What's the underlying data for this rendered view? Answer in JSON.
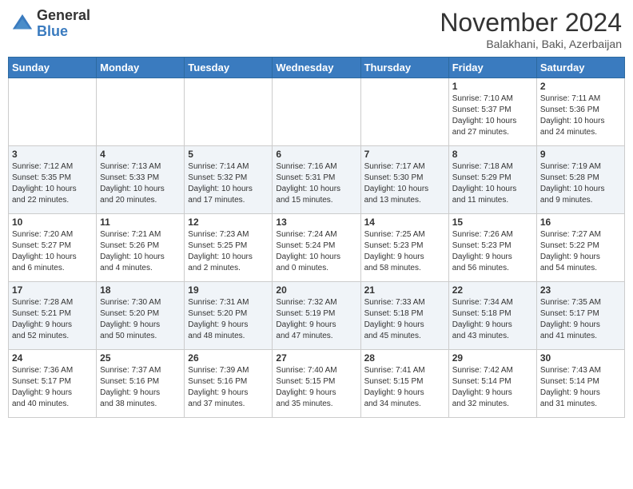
{
  "header": {
    "logo_general": "General",
    "logo_blue": "Blue",
    "month_title": "November 2024",
    "location": "Balakhani, Baki, Azerbaijan"
  },
  "calendar": {
    "days_of_week": [
      "Sunday",
      "Monday",
      "Tuesday",
      "Wednesday",
      "Thursday",
      "Friday",
      "Saturday"
    ],
    "weeks": [
      [
        {
          "day": "",
          "info": ""
        },
        {
          "day": "",
          "info": ""
        },
        {
          "day": "",
          "info": ""
        },
        {
          "day": "",
          "info": ""
        },
        {
          "day": "",
          "info": ""
        },
        {
          "day": "1",
          "info": "Sunrise: 7:10 AM\nSunset: 5:37 PM\nDaylight: 10 hours\nand 27 minutes."
        },
        {
          "day": "2",
          "info": "Sunrise: 7:11 AM\nSunset: 5:36 PM\nDaylight: 10 hours\nand 24 minutes."
        }
      ],
      [
        {
          "day": "3",
          "info": "Sunrise: 7:12 AM\nSunset: 5:35 PM\nDaylight: 10 hours\nand 22 minutes."
        },
        {
          "day": "4",
          "info": "Sunrise: 7:13 AM\nSunset: 5:33 PM\nDaylight: 10 hours\nand 20 minutes."
        },
        {
          "day": "5",
          "info": "Sunrise: 7:14 AM\nSunset: 5:32 PM\nDaylight: 10 hours\nand 17 minutes."
        },
        {
          "day": "6",
          "info": "Sunrise: 7:16 AM\nSunset: 5:31 PM\nDaylight: 10 hours\nand 15 minutes."
        },
        {
          "day": "7",
          "info": "Sunrise: 7:17 AM\nSunset: 5:30 PM\nDaylight: 10 hours\nand 13 minutes."
        },
        {
          "day": "8",
          "info": "Sunrise: 7:18 AM\nSunset: 5:29 PM\nDaylight: 10 hours\nand 11 minutes."
        },
        {
          "day": "9",
          "info": "Sunrise: 7:19 AM\nSunset: 5:28 PM\nDaylight: 10 hours\nand 9 minutes."
        }
      ],
      [
        {
          "day": "10",
          "info": "Sunrise: 7:20 AM\nSunset: 5:27 PM\nDaylight: 10 hours\nand 6 minutes."
        },
        {
          "day": "11",
          "info": "Sunrise: 7:21 AM\nSunset: 5:26 PM\nDaylight: 10 hours\nand 4 minutes."
        },
        {
          "day": "12",
          "info": "Sunrise: 7:23 AM\nSunset: 5:25 PM\nDaylight: 10 hours\nand 2 minutes."
        },
        {
          "day": "13",
          "info": "Sunrise: 7:24 AM\nSunset: 5:24 PM\nDaylight: 10 hours\nand 0 minutes."
        },
        {
          "day": "14",
          "info": "Sunrise: 7:25 AM\nSunset: 5:23 PM\nDaylight: 9 hours\nand 58 minutes."
        },
        {
          "day": "15",
          "info": "Sunrise: 7:26 AM\nSunset: 5:23 PM\nDaylight: 9 hours\nand 56 minutes."
        },
        {
          "day": "16",
          "info": "Sunrise: 7:27 AM\nSunset: 5:22 PM\nDaylight: 9 hours\nand 54 minutes."
        }
      ],
      [
        {
          "day": "17",
          "info": "Sunrise: 7:28 AM\nSunset: 5:21 PM\nDaylight: 9 hours\nand 52 minutes."
        },
        {
          "day": "18",
          "info": "Sunrise: 7:30 AM\nSunset: 5:20 PM\nDaylight: 9 hours\nand 50 minutes."
        },
        {
          "day": "19",
          "info": "Sunrise: 7:31 AM\nSunset: 5:20 PM\nDaylight: 9 hours\nand 48 minutes."
        },
        {
          "day": "20",
          "info": "Sunrise: 7:32 AM\nSunset: 5:19 PM\nDaylight: 9 hours\nand 47 minutes."
        },
        {
          "day": "21",
          "info": "Sunrise: 7:33 AM\nSunset: 5:18 PM\nDaylight: 9 hours\nand 45 minutes."
        },
        {
          "day": "22",
          "info": "Sunrise: 7:34 AM\nSunset: 5:18 PM\nDaylight: 9 hours\nand 43 minutes."
        },
        {
          "day": "23",
          "info": "Sunrise: 7:35 AM\nSunset: 5:17 PM\nDaylight: 9 hours\nand 41 minutes."
        }
      ],
      [
        {
          "day": "24",
          "info": "Sunrise: 7:36 AM\nSunset: 5:17 PM\nDaylight: 9 hours\nand 40 minutes."
        },
        {
          "day": "25",
          "info": "Sunrise: 7:37 AM\nSunset: 5:16 PM\nDaylight: 9 hours\nand 38 minutes."
        },
        {
          "day": "26",
          "info": "Sunrise: 7:39 AM\nSunset: 5:16 PM\nDaylight: 9 hours\nand 37 minutes."
        },
        {
          "day": "27",
          "info": "Sunrise: 7:40 AM\nSunset: 5:15 PM\nDaylight: 9 hours\nand 35 minutes."
        },
        {
          "day": "28",
          "info": "Sunrise: 7:41 AM\nSunset: 5:15 PM\nDaylight: 9 hours\nand 34 minutes."
        },
        {
          "day": "29",
          "info": "Sunrise: 7:42 AM\nSunset: 5:14 PM\nDaylight: 9 hours\nand 32 minutes."
        },
        {
          "day": "30",
          "info": "Sunrise: 7:43 AM\nSunset: 5:14 PM\nDaylight: 9 hours\nand 31 minutes."
        }
      ]
    ]
  }
}
